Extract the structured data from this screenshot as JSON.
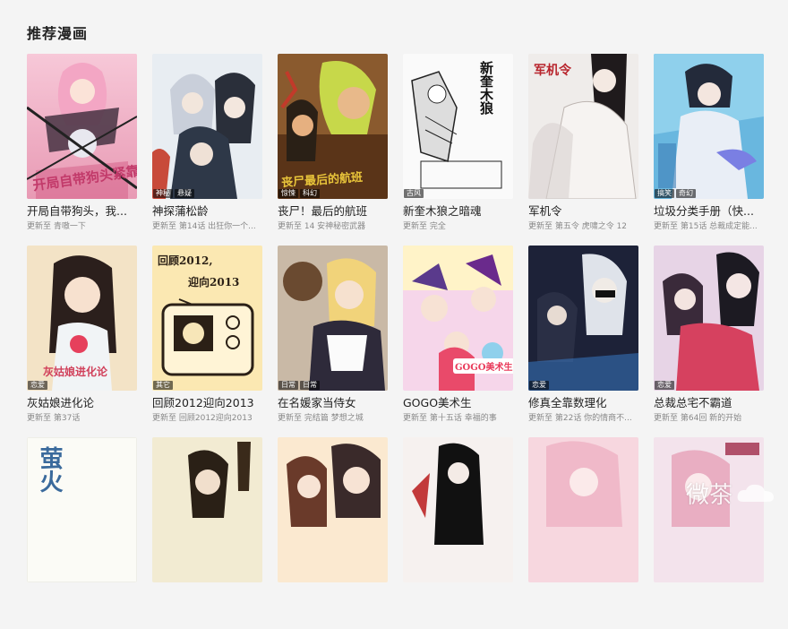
{
  "section": {
    "title": "推荐漫画"
  },
  "cards": [
    {
      "title": "开局自带狗头，我...",
      "meta": "更新至 青嗷一下",
      "tags": [],
      "cover_text": "开局自带狗头紧靠",
      "bg": "#f1c6d4",
      "fg": "#c23a6a"
    },
    {
      "title": "神探蒲松龄",
      "meta": "更新至 第14话 出狂你一个...",
      "tags": [
        "神秘",
        "悬疑"
      ],
      "cover_text": "",
      "bg": "#e8edf2",
      "fg": "#3b4c5e"
    },
    {
      "title": "丧尸！最后的航班",
      "meta": "更新至 14 安神秘密武器",
      "tags": [
        "惊悚",
        "科幻"
      ],
      "cover_text": "丧尸最后的航班",
      "bg": "#6a3b1e",
      "fg": "#d6c23a"
    },
    {
      "title": "新奎木狼之暗魂",
      "meta": "更新至 完全",
      "tags": [
        "古风"
      ],
      "cover_text": "新奎木狼",
      "bg": "#fafafa",
      "fg": "#1b1b1b"
    },
    {
      "title": "军机令",
      "meta": "更新至 第五令 虎啸之令 12",
      "tags": [],
      "cover_text": "军机令",
      "bg": "#efeceb",
      "fg": "#2a1f22"
    },
    {
      "title": "垃圾分类手册（快...",
      "meta": "更新至 第15话 总裁成定能...",
      "tags": [
        "搞笑",
        "奇幻"
      ],
      "cover_text": "",
      "bg": "#7cc3e4",
      "fg": "#2d3e66"
    },
    {
      "title": "灰姑娘进化论",
      "meta": "更新至 第37话",
      "tags": [
        "恋爱"
      ],
      "cover_text": "灰姑娘进化论",
      "bg": "#f3e3c6",
      "fg": "#d1415b"
    },
    {
      "title": "回顾2012迎向2013",
      "meta": "更新至 回顾2012迎向2013",
      "tags": [
        "其它"
      ],
      "cover_text_1": "回顾2012,",
      "cover_text_2": "迎向2013",
      "bg": "#fbe8b2",
      "fg": "#3a2b1c"
    },
    {
      "title": "在名媛家当侍女",
      "meta": "更新至 完结篇 梦想之城",
      "tags": [
        "日常",
        "日常"
      ],
      "cover_text": "",
      "bg": "#d8cbbb",
      "fg": "#4a2a1a"
    },
    {
      "title": "GOGO美术生",
      "meta": "更新至 第十五话 幸福的事",
      "tags": [],
      "cover_text": "GOGO美术生",
      "bg": "#f0d3e6",
      "fg": "#6a2a8c"
    },
    {
      "title": "修真全靠数理化",
      "meta": "更新至 第22话 你的情商不...",
      "tags": [
        "恋爱"
      ],
      "cover_text": "",
      "bg": "#1d2238",
      "fg": "#c8d2e6"
    },
    {
      "title": "总裁总宅不霸道",
      "meta": "更新至 第64回 新的开始",
      "tags": [
        "恋爱"
      ],
      "cover_text": "",
      "bg": "#e7d4e6",
      "fg": "#6a2a4e"
    },
    {
      "title": "",
      "meta": "",
      "tags": [],
      "cover_text": "萤火",
      "bg": "#fbfbf6",
      "fg": "#3a6a9c"
    },
    {
      "title": "",
      "meta": "",
      "tags": [],
      "cover_text": "",
      "bg": "#f2ebd2",
      "fg": "#4a3a2a"
    },
    {
      "title": "",
      "meta": "",
      "tags": [],
      "cover_text": "",
      "bg": "#fbe9d0",
      "fg": "#6a3a2a"
    },
    {
      "title": "",
      "meta": "",
      "tags": [],
      "cover_text": "",
      "bg": "#f6f1ef",
      "fg": "#111111"
    },
    {
      "title": "",
      "meta": "",
      "tags": [],
      "cover_text": "",
      "bg": "#f7d7df",
      "fg": "#c48aa0"
    },
    {
      "title": "",
      "meta": "",
      "tags": [],
      "cover_text": "",
      "bg": "#f3e3ec",
      "fg": "#b0506a"
    }
  ],
  "watermark": {
    "text": "微茶"
  }
}
